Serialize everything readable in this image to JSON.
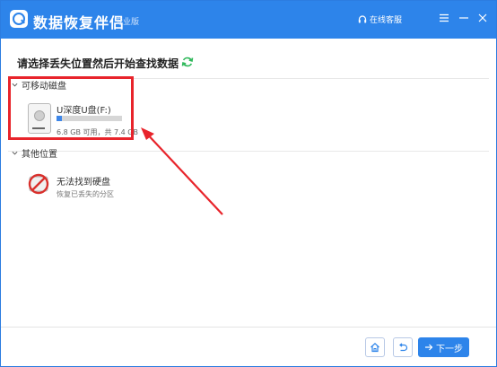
{
  "app": {
    "title": "数据恢复伴侣",
    "edition": "专业版",
    "support_label": "在线客服",
    "accent_color": "#2d84ea",
    "highlight_color": "#e8242b"
  },
  "main": {
    "heading": "请选择丢失位置然后开始查找数据"
  },
  "removable": {
    "header": "可移动磁盘",
    "drives": [
      {
        "name": "U深度U盘(F:)",
        "size_text": "6.8 GB 可用，共 7.4 GB",
        "used_fraction": 0.08,
        "icon": "usb-drive-icon"
      }
    ]
  },
  "other": {
    "header": "其他位置",
    "items": [
      {
        "title": "无法找到硬盘",
        "subtitle": "恢复已丢失的分区",
        "icon": "no-disk-icon"
      }
    ]
  },
  "footer": {
    "next_label": "下一步",
    "home_icon": "home-icon",
    "back_icon": "back-icon"
  }
}
